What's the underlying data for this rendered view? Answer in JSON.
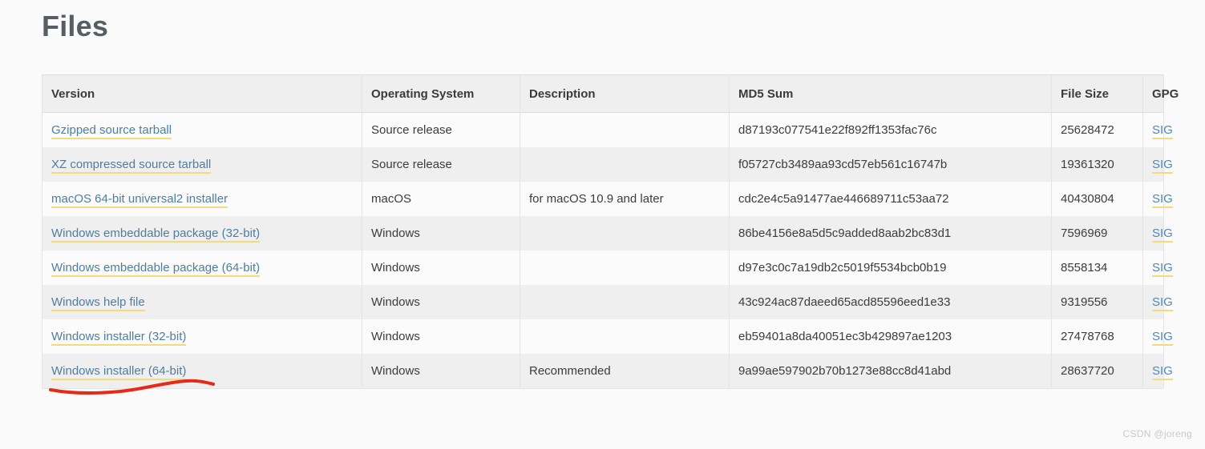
{
  "page": {
    "title": "Files",
    "background_color": "#fafafa",
    "watermark": "CSDN @joreng"
  },
  "colors": {
    "link": "#4f7d9e",
    "link_underline": "#f5d97a",
    "header_bg": "#efefef",
    "row_alt_bg": "#efefef",
    "row_bg": "#fbfbfb",
    "border": "#e4e4e4",
    "annotation": "#e52a1a",
    "title_text": "#555f63"
  },
  "table": {
    "columns": [
      {
        "key": "version",
        "label": "Version"
      },
      {
        "key": "os",
        "label": "Operating System"
      },
      {
        "key": "description",
        "label": "Description"
      },
      {
        "key": "md5",
        "label": "MD5 Sum"
      },
      {
        "key": "size",
        "label": "File Size"
      },
      {
        "key": "gpg",
        "label": "GPG"
      }
    ],
    "rows": [
      {
        "version": "Gzipped source tarball",
        "os": "Source release",
        "description": "",
        "md5": "d87193c077541e22f892ff1353fac76c",
        "size": "25628472",
        "gpg": "SIG"
      },
      {
        "version": "XZ compressed source tarball",
        "os": "Source release",
        "description": "",
        "md5": "f05727cb3489aa93cd57eb561c16747b",
        "size": "19361320",
        "gpg": "SIG"
      },
      {
        "version": "macOS 64-bit universal2 installer",
        "os": "macOS",
        "description": "for macOS 10.9 and later",
        "md5": "cdc2e4c5a91477ae446689711c53aa72",
        "size": "40430804",
        "gpg": "SIG"
      },
      {
        "version": "Windows embeddable package (32-bit)",
        "os": "Windows",
        "description": "",
        "md5": "86be4156e8a5d5c9added8aab2bc83d1",
        "size": "7596969",
        "gpg": "SIG"
      },
      {
        "version": "Windows embeddable package (64-bit)",
        "os": "Windows",
        "description": "",
        "md5": "d97e3c0c7a19db2c5019f5534bcb0b19",
        "size": "8558134",
        "gpg": "SIG"
      },
      {
        "version": "Windows help file",
        "os": "Windows",
        "description": "",
        "md5": "43c924ac87daeed65acd85596eed1e33",
        "size": "9319556",
        "gpg": "SIG"
      },
      {
        "version": "Windows installer (32-bit)",
        "os": "Windows",
        "description": "",
        "md5": "eb59401a8da40051ec3b429897ae1203",
        "size": "27478768",
        "gpg": "SIG"
      },
      {
        "version": "Windows installer (64-bit)",
        "os": "Windows",
        "description": "Recommended",
        "md5": "9a99ae597902b70b1273e88cc8d41abd",
        "size": "28637720",
        "gpg": "SIG"
      }
    ]
  },
  "annotation": {
    "type": "hand-drawn-underline",
    "target_row_index": 7,
    "target_text": "Windows installer (64-bit)",
    "color": "#e52a1a"
  }
}
